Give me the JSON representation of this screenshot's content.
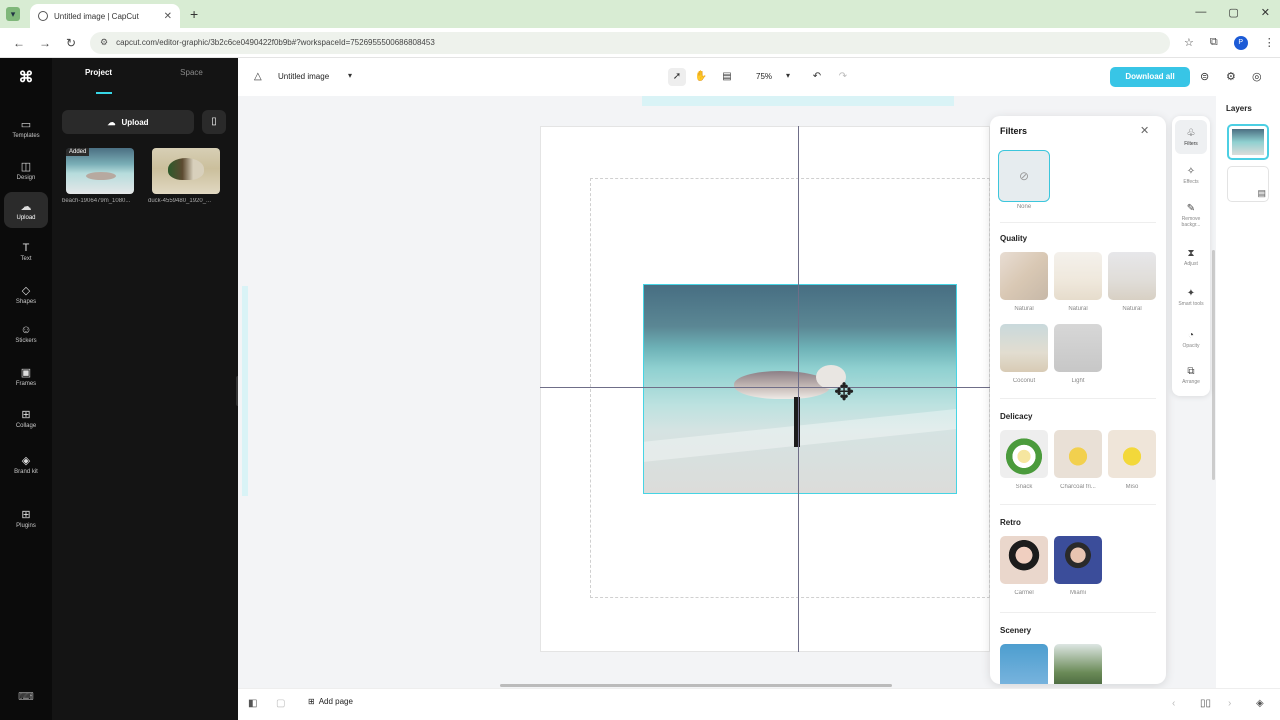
{
  "browser": {
    "tab_title": "Untitled image | CapCut",
    "tab_close": "✕",
    "new_tab": "+",
    "url": "capcut.com/editor-graphic/3b2c6ce0490422f0b9b#?workspaceId=7526955500686808453",
    "window_controls": [
      "—",
      "▢",
      "✕"
    ]
  },
  "rail": {
    "logo": "CapCut",
    "items": [
      {
        "label": "Templates",
        "icon": "▭"
      },
      {
        "label": "Design",
        "icon": "◫"
      },
      {
        "label": "Upload",
        "icon": "☁"
      },
      {
        "label": "Text",
        "icon": "T"
      },
      {
        "label": "Shapes",
        "icon": "◇"
      },
      {
        "label": "Stickers",
        "icon": "☺"
      },
      {
        "label": "Frames",
        "icon": "▣"
      },
      {
        "label": "Collage",
        "icon": "⊞"
      },
      {
        "label": "Brand kit",
        "icon": "◈"
      },
      {
        "label": "Plugins",
        "icon": "⊞"
      }
    ]
  },
  "panel": {
    "tabs": [
      "Project",
      "Space"
    ],
    "upload_label": "Upload",
    "thumbs": [
      {
        "badge": "Added",
        "caption": "beach-1906479m_1080..."
      },
      {
        "badge": "",
        "caption": "duck-4559480_1920_..."
      }
    ]
  },
  "topbar": {
    "doc_title": "Untitled image",
    "zoom": "75%",
    "download_label": "Download all"
  },
  "filters": {
    "title": "Filters",
    "none_label": "None",
    "sections": [
      {
        "name": "Quality",
        "items": [
          "Natural",
          "Natural",
          "Natural",
          "Coconut",
          "Light"
        ]
      },
      {
        "name": "Delicacy",
        "items": [
          "Snack",
          "Charcoal fri...",
          "Miso"
        ]
      },
      {
        "name": "Retro",
        "items": [
          "Carmel",
          "Miami"
        ]
      },
      {
        "name": "Scenery",
        "items": [
          "",
          ""
        ]
      }
    ]
  },
  "toolcol": {
    "items": [
      "Filters",
      "Effects",
      "Remove backgr...",
      "Adjust",
      "Smart tools",
      "Opacity",
      "Arrange"
    ]
  },
  "layers": {
    "title": "Layers"
  },
  "bottombar": {
    "add_page": "Add page"
  },
  "colors": {
    "accent": "#38c5e6",
    "rail_bg": "#0b0b0b",
    "panel_bg": "#141414"
  }
}
